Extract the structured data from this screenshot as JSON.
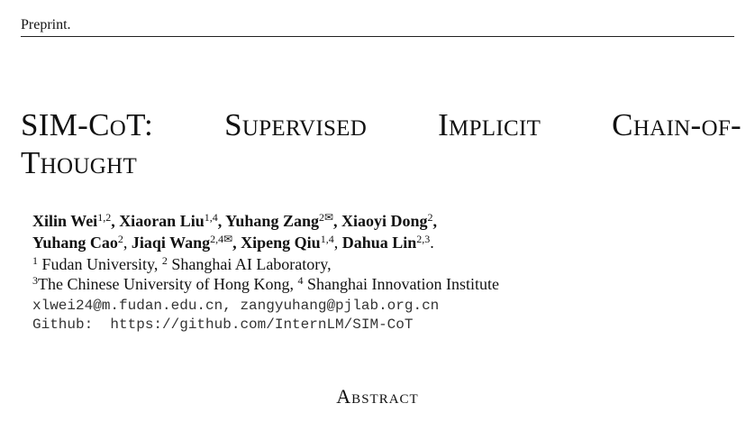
{
  "header": {
    "text": "Preprint."
  },
  "title": {
    "sim": "SIM-C",
    "o": "o",
    "t": "T:",
    "w1": "Supervised",
    "w2": "Implicit",
    "w3": "Chain-of-",
    "w4": "Thought"
  },
  "authors": [
    {
      "name": "Xilin Wei",
      "sup": "1,2",
      "sep": ", "
    },
    {
      "name": "Xiaoran Liu",
      "sup": "1,4",
      "sep": ", "
    },
    {
      "name": "Yuhang Zang",
      "sup": "2✉",
      "sep": ", "
    },
    {
      "name": "Xiaoyi Dong",
      "sup": "2",
      "sep": ","
    },
    {
      "name": "Yuhang Cao",
      "sup": "2",
      "sep": ", "
    },
    {
      "name": "Jiaqi Wang",
      "sup": "2,4✉",
      "sep": ", "
    },
    {
      "name": "Xipeng Qiu",
      "sup": "1,4",
      "sep": ", "
    },
    {
      "name": "Dahua Lin",
      "sup": "2,3",
      "sep": "."
    }
  ],
  "affiliations": {
    "line1": {
      "s1": "1",
      "t1": " Fudan University, ",
      "s2": "2",
      "t2": " Shanghai AI Laboratory,"
    },
    "line2": {
      "s3": "3",
      "t3": "The Chinese University of Hong Kong, ",
      "s4": "4",
      "t4": " Shanghai Innovation Institute"
    }
  },
  "emails": "xlwei24@m.fudan.edu.cn, zangyuhang@pjlab.org.cn",
  "github": "Github:  https://github.com/InternLM/SIM-CoT",
  "abstract_heading": "Abstract"
}
